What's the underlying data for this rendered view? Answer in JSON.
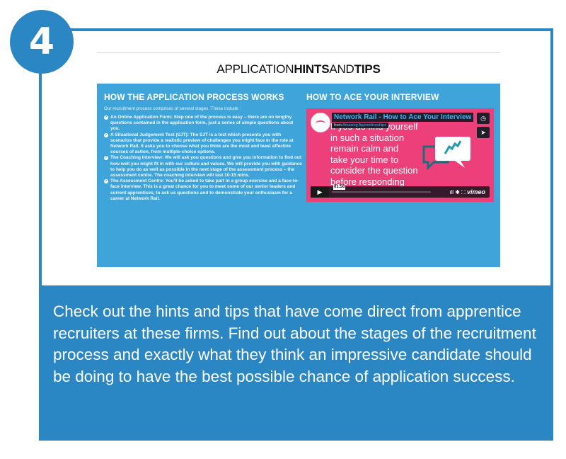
{
  "step_number": "4",
  "page_title": {
    "part1": "APPLICATION",
    "part2": "HINTS",
    "part3": "AND",
    "part4": "TIPS"
  },
  "left_column": {
    "title": "HOW THE APPLICATION PROCESS WORKS",
    "intro": "Our recruitment process comprises of several stages. These include :",
    "steps": [
      "An Online Application Form: Step one of the process is easy – there are no lengthy questions contained in the application form, just a series of simple questions about you.",
      "A Situational Judgement Test (SJT): The SJT is a test which presents you with scenarios that provide a realistic preview of challenges you might face in the role at Network Rail. It asks you to choose what you think are the most and least effective courses of action, from multiple-choice options.",
      "The Coaching Interview: We will ask you questions and give you information to find out how well you might fit in with our culture and values. We will provide you with guidance to help you do as well as possible in the next stage of the assessment process – the assessment centre. The coaching interview will last 10-15 mins.",
      "The Assessment Centre: You'll be asked to take part in a group exercise and a face-to-face interview. This is a great chance for you to meet some of our senior leaders and current apprentices, to ask us questions and to demonstrate your enthusiasm for a career at Network Rail."
    ]
  },
  "right_column": {
    "title": "HOW TO ACE YOUR INTERVIEW",
    "video": {
      "title": "Network Rail - How to Ace Your Interview",
      "from_label": "from",
      "from_channel": "Amazing Apprenticeships",
      "slide_lines": [
        "If you do find yourself",
        "in such a situation",
        "remain calm and",
        "take your time to",
        "consider the question",
        "before responding"
      ],
      "timestamp": "01:56",
      "brand": "vimeo"
    }
  },
  "caption": "Check out the hints and tips that have come direct from apprentice recruiters at these firms. Find out about the stages of the recruitment process and exactly what they think an impressive candidate should be doing to have the best possible chance of application success."
}
